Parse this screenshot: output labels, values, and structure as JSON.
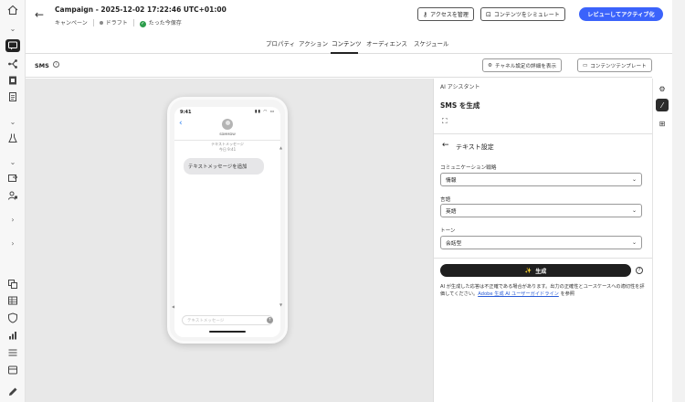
{
  "header": {
    "title": "Campaign - 2025-12-02 17:22:46 UTC+01:00",
    "type_label": "キャンペーン",
    "status_label": "ドラフト",
    "save_label": "たった今保存",
    "manage_access_label": "アクセスを管理",
    "simulate_label": "コンテンツをシミュレート",
    "review_activate_label": "レビューしてアクティブ化"
  },
  "tabs": [
    {
      "label": "プロパティ"
    },
    {
      "label": "アクション"
    },
    {
      "label": "コンテンツ",
      "active": true
    },
    {
      "label": "オーディエンス"
    },
    {
      "label": "スケジュール"
    }
  ],
  "channel_bar": {
    "label": "SMS",
    "channel_settings_label": "チャネル設定の詳細を表示",
    "templates_label": "コンテンツテンプレート"
  },
  "phone_preview": {
    "time": "9:41",
    "contact": "SDMMDW",
    "meta_line1": "テキストメッセージ",
    "meta_line2": "今日 9:41",
    "bubble_text": "テキストメッセージを追加",
    "compose_placeholder": "テキストメッセージ"
  },
  "ai_panel": {
    "section_label": "AI アシスタント",
    "title": "SMS を生成",
    "settings_title": "テキスト設定",
    "fields": [
      {
        "label": "コミュニケーション戦略",
        "value": "情報"
      },
      {
        "label": "言語",
        "value": "英語"
      },
      {
        "label": "トーン",
        "value": "会話型"
      }
    ],
    "generate_label": "生成",
    "disclaimer_text": "AI が生成した応答は不正確である場合があります。出力の正確性とユースケースへの適切性を評価してください。",
    "disclaimer_link": "Adobe 生成 AI ユーザーガイドライン",
    "disclaimer_suffix": "を参照"
  },
  "icons": {
    "left_rail": [
      "home-icon",
      "chevron-down-icon",
      "message-icon",
      "journey-icon",
      "content-icon",
      "document-icon",
      "chevron-down-icon",
      "flask-icon",
      "chevron-down-icon",
      "offer-icon",
      "audience-icon",
      "chevron-right-icon",
      "chevron-right-icon",
      "fragment-icon",
      "table-icon",
      "shield-icon",
      "chart-icon",
      "list-icon",
      "library-icon",
      "edit-icon"
    ],
    "tool_rail": [
      "gear-icon",
      "magic-wand-icon",
      "variants-icon"
    ]
  },
  "colors": {
    "primary": "#3b63fb",
    "saved_green": "#2d9d4c",
    "generate_button": "#1f1f1f",
    "link": "#2a5cd6"
  }
}
